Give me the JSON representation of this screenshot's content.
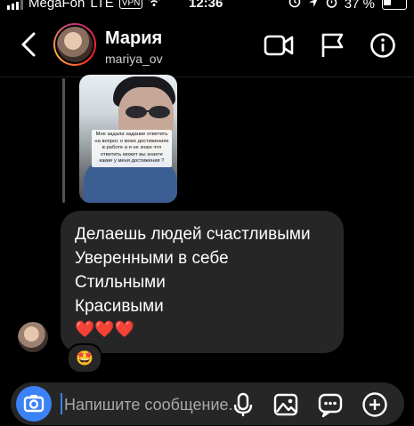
{
  "status_bar": {
    "carrier": "MegaFon",
    "network": "LTE",
    "vpn": "VPN",
    "time": "12:36",
    "battery": "37 %"
  },
  "header": {
    "name": "Мария",
    "username": "mariya_ov"
  },
  "story_reply": {
    "caption": "Мне задали задание ответить на вопрос о моих достижениях в работе а я не знаю что ответить может вы знаете какие у меня достижения ?"
  },
  "message": {
    "lines": [
      "Делаешь людей счастливыми",
      "Уверенными в себе",
      "Стильными",
      "Красивыми",
      "❤️❤️❤️"
    ],
    "reaction": "🤩"
  },
  "composer": {
    "placeholder": "Напишите сообщение..."
  },
  "colors": {
    "bubble": "#262626",
    "accent": "#3b82f6"
  }
}
